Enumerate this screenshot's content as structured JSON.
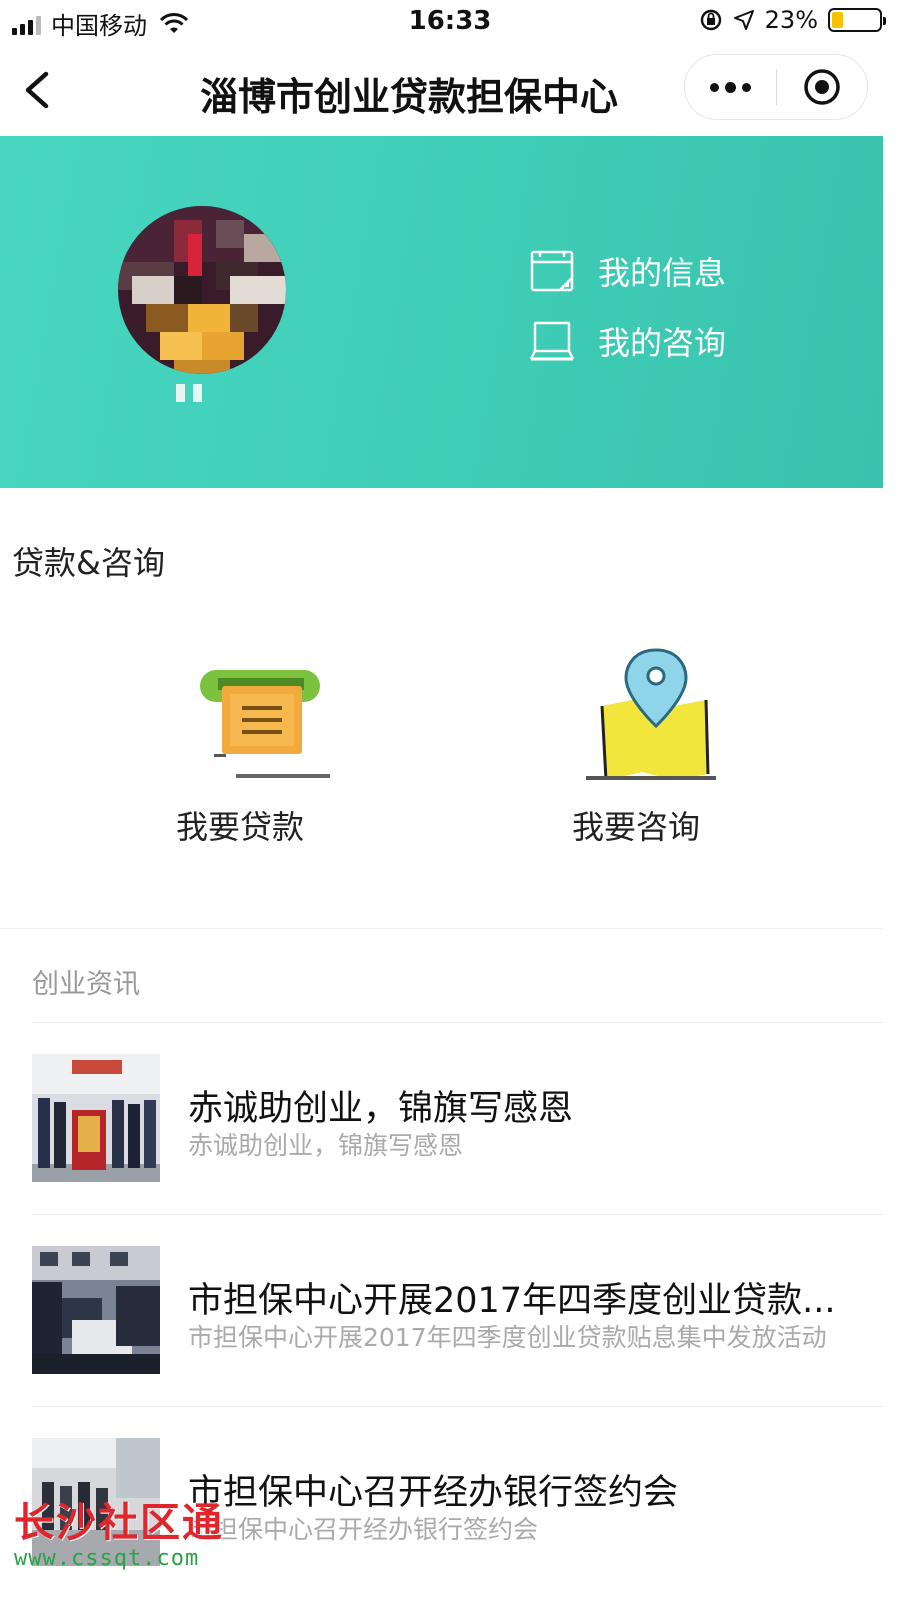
{
  "status_bar": {
    "carrier": "中国移动",
    "time": "16:33",
    "battery": "23%",
    "battery_level": 0.23
  },
  "nav": {
    "title": "淄博市创业贷款担保中心"
  },
  "banner": {
    "links": [
      {
        "label": "我的信息",
        "icon": "calendar-note-icon"
      },
      {
        "label": "我的咨询",
        "icon": "laptop-icon"
      }
    ],
    "colors": {
      "gradient_start": "#48d6c0",
      "gradient_end": "#3bc2ae"
    }
  },
  "services": {
    "title": "贷款&咨询",
    "items": [
      {
        "label": "我要贷款",
        "icon": "loan-receipt-icon"
      },
      {
        "label": "我要咨询",
        "icon": "map-pin-icon"
      }
    ]
  },
  "news": {
    "header": "创业资讯",
    "items": [
      {
        "title": "赤诚助创业，锦旗写感恩",
        "summary": "赤诚助创业，锦旗写感恩"
      },
      {
        "title": "市担保中心开展2017年四季度创业贷款...",
        "summary": "市担保中心开展2017年四季度创业贷款贴息集中发放活动"
      },
      {
        "title": "市担保中心召开经办银行签约会",
        "summary": "市担保中心召开经办银行签约会"
      }
    ]
  },
  "watermark": {
    "title": "长沙社区通",
    "url": "www.cssqt.com"
  }
}
